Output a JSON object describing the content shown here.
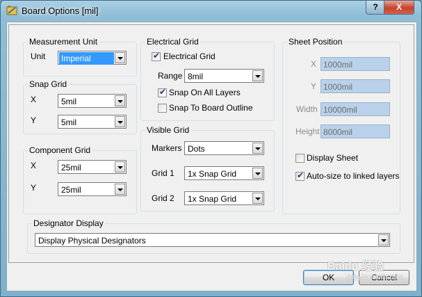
{
  "window": {
    "title": "Board Options [mil]",
    "help_label": "?",
    "close_label": "X"
  },
  "measurement": {
    "title": "Measurement Unit",
    "unit_label": "Unit",
    "unit_value": "Imperial"
  },
  "snap_grid": {
    "title": "Snap Grid",
    "x_label": "X",
    "x_value": "5mil",
    "y_label": "Y",
    "y_value": "5mil"
  },
  "component_grid": {
    "title": "Component Grid",
    "x_label": "X",
    "x_value": "25mil",
    "y_label": "Y",
    "y_value": "25mil"
  },
  "electrical_grid": {
    "title": "Electrical Grid",
    "enable_label": "Electrical Grid",
    "enable_checked": true,
    "range_label": "Range",
    "range_value": "8mil",
    "snap_all_label": "Snap On All Layers",
    "snap_all_checked": true,
    "snap_outline_label": "Snap To Board Outline",
    "snap_outline_checked": false
  },
  "visible_grid": {
    "title": "Visible Grid",
    "markers_label": "Markers",
    "markers_value": "Dots",
    "grid1_label": "Grid 1",
    "grid1_value": "1x Snap Grid",
    "grid2_label": "Grid 2",
    "grid2_value": "1x Snap Grid"
  },
  "sheet_position": {
    "title": "Sheet Position",
    "x_label": "X",
    "x_value": "1000mil",
    "y_label": "Y",
    "y_value": "1000mil",
    "width_label": "Width",
    "width_value": "10000mil",
    "height_label": "Height",
    "height_value": "8000mil",
    "display_sheet_label": "Display Sheet",
    "display_sheet_checked": false,
    "autosize_label": "Auto-size to linked layers",
    "autosize_checked": true
  },
  "designator": {
    "title": "Designator Display",
    "value": "Display Physical Designators"
  },
  "buttons": {
    "ok_label": "OK",
    "cancel_label": "Cancel"
  },
  "watermark": {
    "text": "Baidu 经验",
    "sub": "jingyan.baidu.com"
  },
  "colors": {
    "selection": "#3399ff",
    "disabled_field": "#b9d1ea",
    "title_gradient": "#a9cfe3"
  }
}
